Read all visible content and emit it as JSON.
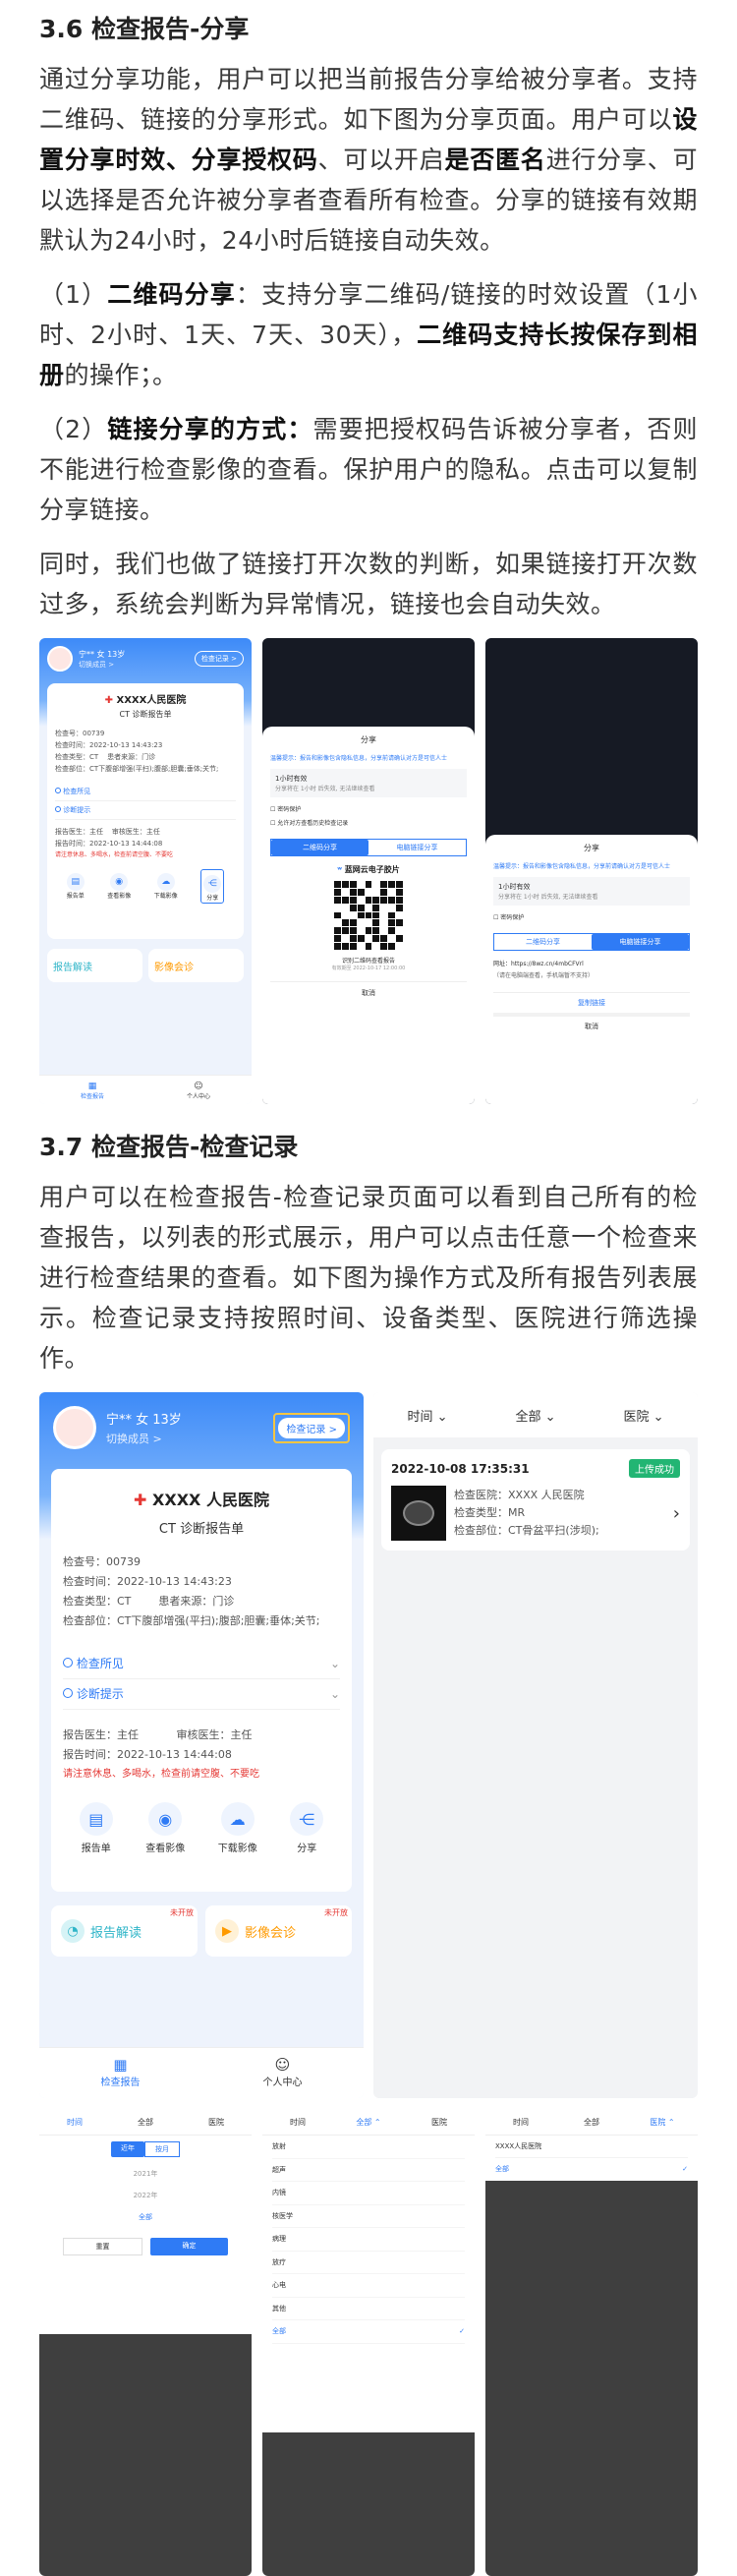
{
  "s36": {
    "heading": "3.6  检查报告-分享",
    "p1a": "通过分享功能，用户可以把当前报告分享给被分享者。支持二维码、链接的分享形式。如下图为分享页面。用户可以",
    "p1b": "设置分享时效、分享授权码",
    "p1c": "、可以开启",
    "p1d": "是否匿名",
    "p1e": "进行分享、可以选择是否允许被分享者查看所有检查。分享的链接有效期默认为24小时，24小时后链接自动失效。",
    "p2a": "（1）",
    "p2b": "二维码分享",
    "p2c": "：支持分享二维码/链接的时效设置（1小时、2小时、1天、7天、30天），",
    "p2d": "二维码支持长按保存到相册",
    "p2e": "的操作；。",
    "p3a": "（2）",
    "p3b": "链接分享的方式：",
    "p3c": "需要把授权码告诉被分享者，否则不能进行检查影像的查看。保护用户的隐私。点击可以复制分享链接。",
    "p4": "同时，我们也做了链接打开次数的判断，如果链接打开次数过多，系统会判断为异常情况，链接也会自动失效。"
  },
  "s37": {
    "heading": "3.7  检查报告-检查记录",
    "p1": "用户可以在检查报告-检查记录页面可以看到自己所有的检查报告，以列表的形式展示，用户可以点击任意一个检查来进行检查结果的查看。如下图为操作方式及所有报告列表展示。检查记录支持按照时间、设备类型、医院进行筛选操作。"
  },
  "report": {
    "user": "宁** 女 13岁",
    "switch": "切换成员 >",
    "records_btn": "检查记录 >",
    "hospital": "XXXX 人民医院",
    "hospital_short": "XXXX人民医院",
    "title": "CT 诊断报告单",
    "rows": [
      {
        "k": "检查号：",
        "v": "00739"
      },
      {
        "k": "检查时间：",
        "v": "2022-10-13 14:43:23"
      },
      {
        "k": "检查类型：",
        "v": "CT",
        "k2": "患者来源：",
        "v2": "门诊"
      },
      {
        "k": "检查部位：",
        "v": "CT下腹部增强(平扫);腹部;胆囊;垂体;关节;"
      }
    ],
    "findings": "检查所见",
    "diagnosis": "诊断提示",
    "doctor_k": "报告医生：",
    "doctor_v": "主任",
    "reviewer_k": "审核医生：",
    "reviewer_v": "主任",
    "rtime_k": "报告时间：",
    "rtime_v": "2022-10-13 14:44:08",
    "notice": "请注意休息、多喝水，检查前请空腹、不要吃",
    "actions": [
      "报告单",
      "查看影像",
      "下载影像",
      "分享"
    ],
    "promo1": "报告解读",
    "promo2": "影像会诊",
    "promo_tag": "未开放",
    "tabs": [
      "检查报告",
      "个人中心"
    ]
  },
  "share": {
    "title": "分享",
    "tip": "温馨提示：报告和影像包含隐私信息，分享前请确认对方是可信人士",
    "valid_title": "1小时有效",
    "valid_desc": "分享将在 1小时 后失效, 无法继续查看",
    "pwd": "密码保护",
    "allow": "允许对方查看历史检查记录",
    "tab_qr": "二维码分享",
    "tab_link": "电脑链接分享",
    "brand": "蓝网云电子胶片",
    "scan": "识别二维码查看报告",
    "expire": "有效期至 2022-10-17 12:00:00",
    "cancel": "取消",
    "url": "网址：https://8wz.cn/4mbCFVrl",
    "url_note": "（请在电脑端查看，手机端暂不支持）",
    "copy": "复制链接"
  },
  "records": {
    "filters": [
      "时间",
      "全部",
      "医院"
    ],
    "datetime": "2022-10-08 17:35:31",
    "badge": "上传成功",
    "hospital_k": "检查医院：",
    "hospital_v": "XXXX 人民医院",
    "type_k": "检查类型：",
    "type_v": "MR",
    "part_k": "检查部位：",
    "part_v": "CT骨盆平扫(涉坝);"
  },
  "filters": {
    "seg": [
      "近年",
      "按月"
    ],
    "years": [
      "2021年",
      "2022年",
      "全部"
    ],
    "reset": "重置",
    "ok": "确定",
    "devices": [
      "放射",
      "超声",
      "内镜",
      "核医学",
      "病理",
      "放疗",
      "心电",
      "其他",
      "全部"
    ],
    "hospitals": [
      "XXXX人民医院",
      "全部"
    ]
  },
  "colors": {
    "accent": "#2f7bf5",
    "red": "#e53935",
    "green": "#22b573",
    "orange": "#ff8a00"
  }
}
